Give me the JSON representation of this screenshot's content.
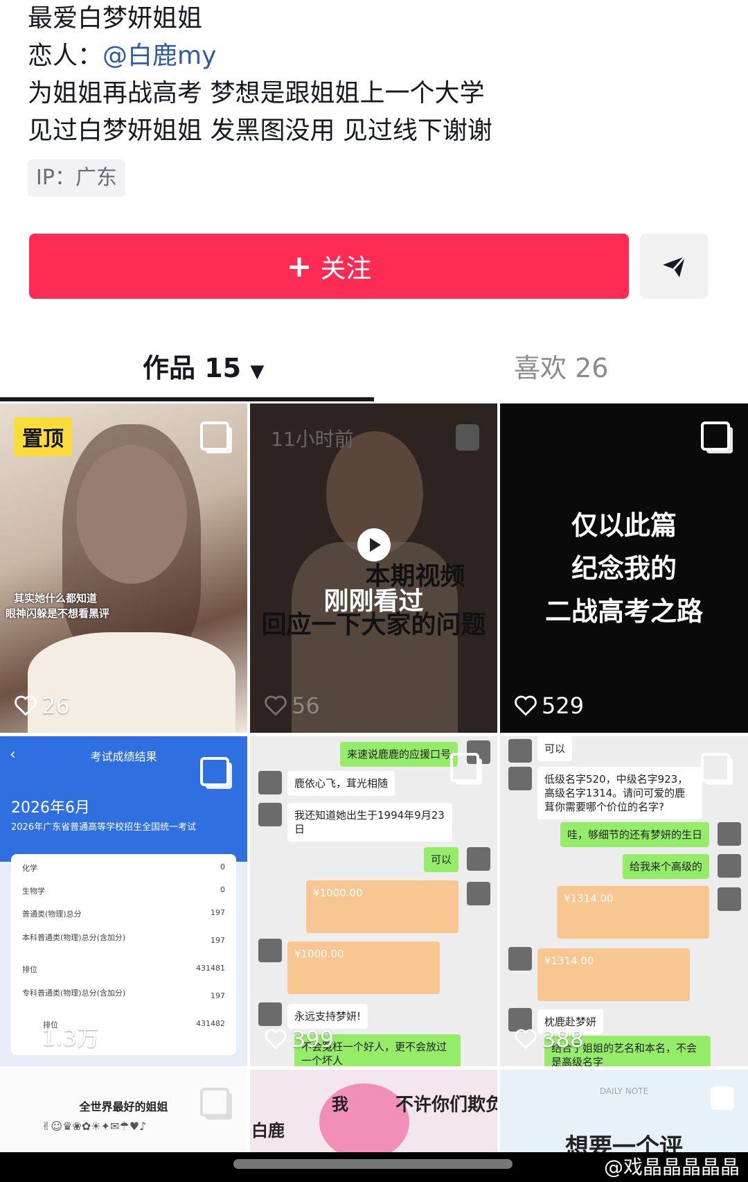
{
  "bio": {
    "line1": "最爱白梦妍姐姐",
    "line2_prefix": "恋人：",
    "line2_mention": "@白鹿my",
    "line3": "为姐姐再战高考  梦想是跟姐姐上一个大学",
    "line4": "见过白梦妍姐姐 发黑图没用 见过线下谢谢",
    "ip": "IP：广东"
  },
  "actions": {
    "follow_label": "关注",
    "follow_plus": "+",
    "share_icon": "send-arrow-icon"
  },
  "tabs": {
    "works": "作品 15",
    "likes": "喜欢 26"
  },
  "grid": {
    "v1": {
      "badge": "置顶",
      "caption1": "其实她什么都知道",
      "caption2": "眼神闪躲是不想看黑评",
      "likes": "26"
    },
    "v2": {
      "time": "11小时前",
      "text1": "本期视频",
      "text2": "刚刚看过",
      "text3": "回应一下大家的问题",
      "likes": "56"
    },
    "v3": {
      "line1": "仅以此篇",
      "line2": "纪念我的",
      "line3": "二战高考之路",
      "likes": "529"
    },
    "v4": {
      "header": "考试成绩结果",
      "date": "2026年6月",
      "subtitle": "2026年广东省普通高等学校招生全国统一考试",
      "rows": [
        {
          "label": "化学",
          "value": "0"
        },
        {
          "label": "生物学",
          "value": "0"
        },
        {
          "label": "普通类(物理)总分",
          "value": "197"
        },
        {
          "label": "本科普通类(物理)总分(含加分)",
          "value": "197"
        },
        {
          "label": "排位",
          "value": "431481"
        },
        {
          "label": "专科普通类(物理)总分(含加分)",
          "value": "197"
        },
        {
          "label": "排位",
          "value": "431482"
        }
      ],
      "likes": "1.3万"
    },
    "v5": {
      "msgs": [
        "来速说鹿鹿的应援口号",
        "鹿依心飞，茸光相随",
        "我还知道她出生于1994年9月23日",
        "可以",
        "¥1000.00",
        "¥1000.00",
        "永远支持梦妍!",
        "不会冤枉一个好人，更不会放过一个坏人"
      ],
      "likes": "399"
    },
    "v6": {
      "msgs": [
        "可以",
        "低级名字520，中级名字923，高级名字1314。请问可爱的鹿茸你需要哪个价位的名字?",
        "哇，够细节的还有梦妍的生日",
        "给我来个高级的",
        "¥1314.00",
        "¥1314.00",
        "枕鹿赴梦妍",
        "结合了姐姐的艺名和本名，不会是高级名字"
      ],
      "likes": "388"
    },
    "v7": {
      "title": "全世界最好的姐姐"
    },
    "v8": {
      "t1": "我",
      "t2": "不许你们欺负",
      "t3": "白鹿"
    },
    "v9": {
      "t1": "DAILY NOTE",
      "t2": "想要一个评"
    }
  },
  "watermark": "@戏晶晶晶晶晶",
  "colors": {
    "accent": "#fe2c55",
    "mention": "#2f5aa8",
    "pin_badge": "#fadc3c"
  }
}
